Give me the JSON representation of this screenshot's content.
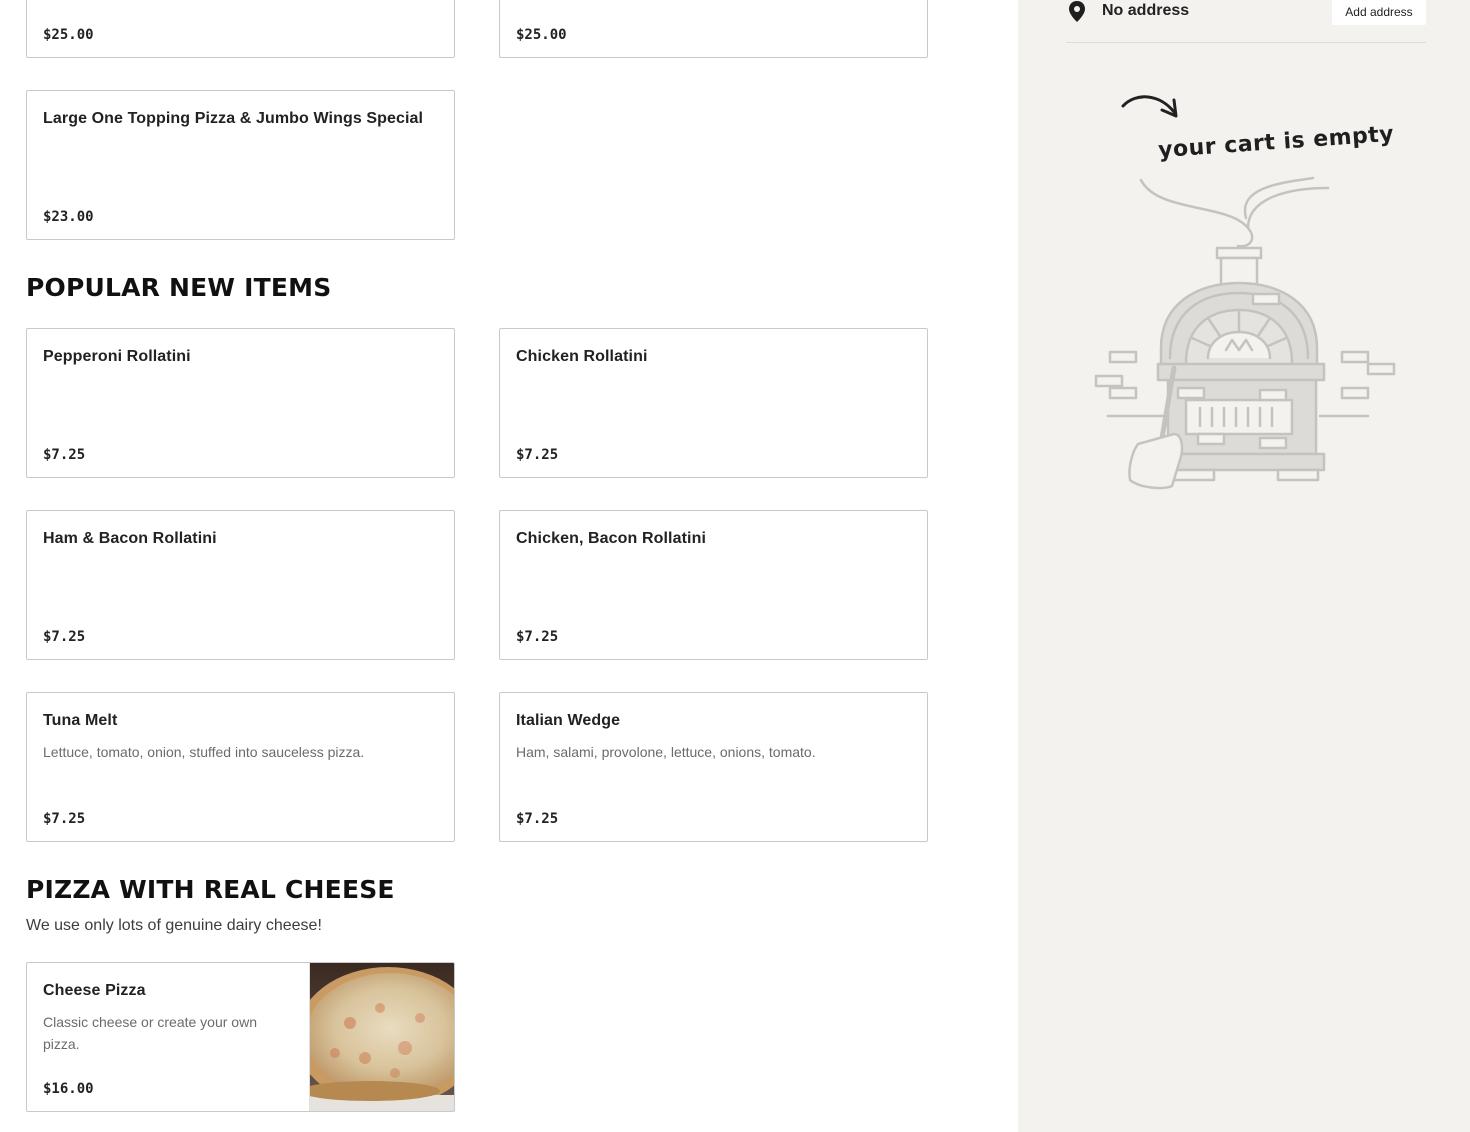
{
  "deals": {
    "items": [
      {
        "price": "$25.00"
      },
      {
        "price": "$25.00"
      },
      {
        "name": "Large One Topping Pizza & Jumbo Wings Special",
        "price": "$23.00"
      }
    ]
  },
  "popular": {
    "title": "POPULAR NEW ITEMS",
    "items": [
      {
        "name": "Pepperoni Rollatini",
        "price": "$7.25"
      },
      {
        "name": "Chicken Rollatini",
        "price": "$7.25"
      },
      {
        "name": "Ham & Bacon Rollatini",
        "price": "$7.25"
      },
      {
        "name": "Chicken, Bacon Rollatini",
        "price": "$7.25"
      },
      {
        "name": "Tuna Melt",
        "desc": "Lettuce, tomato, onion, stuffed into sauceless pizza.",
        "price": "$7.25"
      },
      {
        "name": "Italian Wedge",
        "desc": "Ham, salami, provolone, lettuce, onions, tomato.",
        "price": "$7.25"
      }
    ]
  },
  "cheese": {
    "title": "PIZZA WITH REAL CHEESE",
    "subtitle": "We use only lots of genuine dairy cheese!",
    "items": [
      {
        "name": "Cheese Pizza",
        "desc": "Classic cheese or create your own pizza.",
        "price": "$16.00"
      }
    ]
  },
  "cart": {
    "address_text": "No address",
    "add_address_label": "Add address",
    "empty_text": "your cart is empty",
    "icons": {
      "address": "map-pin-icon",
      "illustration": "pizza-oven-illustration"
    }
  },
  "colors": {
    "sidebar_bg": "#f3f2ef",
    "card_border": "#c9c9c9",
    "illustration_stroke": "#c4c3c0"
  }
}
